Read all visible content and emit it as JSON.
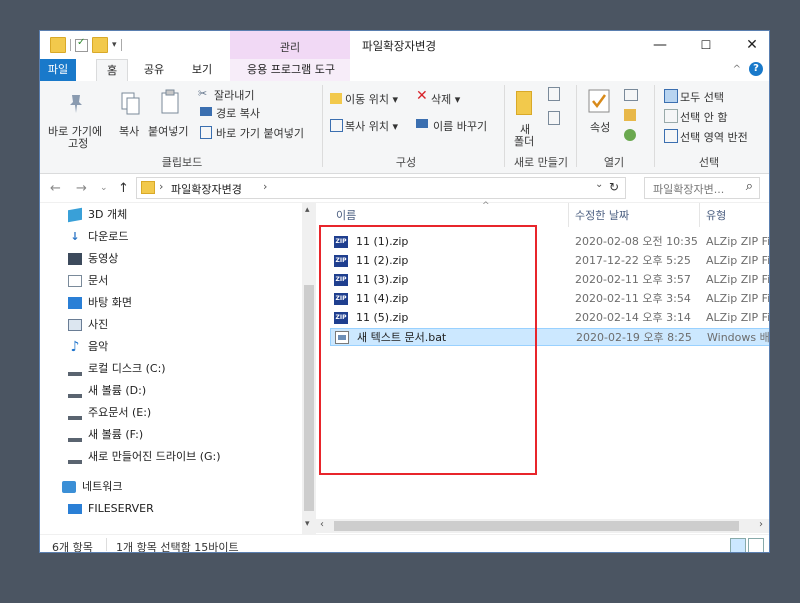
{
  "window": {
    "title": "파일확장자변경",
    "context_tab": "관리",
    "controls": {
      "minimize": "—",
      "maximize": "☐",
      "close": "✕"
    }
  },
  "ribbon_tabs": {
    "file": "파일",
    "home": "홈",
    "share": "공유",
    "view": "보기",
    "app_tools": "응용 프로그램 도구",
    "collapse": "^",
    "help": "?"
  },
  "ribbon": {
    "clipboard": {
      "pin": "바로 가기에\n고정",
      "pin_line1": "바로 가기에",
      "pin_line2": "고정",
      "copy": "복사",
      "paste": "붙여넣기",
      "cut": "잘라내기",
      "copy_path": "경로 복사",
      "paste_shortcut": "바로 가기 붙여넣기",
      "group": "클립보드"
    },
    "organize": {
      "move_to": "이동 위치 ▾",
      "delete": "삭제 ▾",
      "copy_to": "복사 위치 ▾",
      "rename": "이름 바꾸기",
      "group": "구성"
    },
    "new": {
      "new_folder_line1": "새",
      "new_folder_line2": "폴더",
      "group": "새로 만들기"
    },
    "open": {
      "properties": "속성",
      "group": "열기"
    },
    "select": {
      "select_all": "모두 선택",
      "select_none": "선택 안 함",
      "invert": "선택 영역 반전",
      "group": "선택"
    }
  },
  "address": {
    "back": "←",
    "forward": "→",
    "recent": "⌄",
    "up": "↑",
    "path": "파일확장자변경",
    "refresh": "↻",
    "dropdown": "⌄",
    "search_placeholder": "파일확장자변...",
    "search_icon": "⌕"
  },
  "nav_pane": {
    "items": [
      {
        "label": "3D 개체",
        "icon": "cube-icon"
      },
      {
        "label": "다운로드",
        "icon": "download-icon"
      },
      {
        "label": "동영상",
        "icon": "video-icon"
      },
      {
        "label": "문서",
        "icon": "document-icon"
      },
      {
        "label": "바탕 화면",
        "icon": "desktop-icon"
      },
      {
        "label": "사진",
        "icon": "picture-icon"
      },
      {
        "label": "음악",
        "icon": "music-icon"
      },
      {
        "label": "로컬 디스크 (C:)",
        "icon": "drive-icon"
      },
      {
        "label": "새 볼륨 (D:)",
        "icon": "drive-icon"
      },
      {
        "label": "주요문서 (E:)",
        "icon": "drive-icon"
      },
      {
        "label": "새 볼륨 (F:)",
        "icon": "drive-icon"
      },
      {
        "label": "새로 만들어진 드라이브 (G:)",
        "icon": "drive-icon"
      },
      {
        "label": "네트워크",
        "icon": "network-icon"
      },
      {
        "label": "FILESERVER",
        "icon": "computer-icon"
      }
    ]
  },
  "content": {
    "columns": {
      "name": "이름",
      "modified": "수정한 날짜",
      "type": "유형"
    },
    "sort_indicator": "^",
    "files": [
      {
        "name": "11 (1).zip",
        "modified": "2020-02-08 오전 10:35",
        "type": "ALZip ZIP File",
        "kind": "zip",
        "selected": false
      },
      {
        "name": "11 (2).zip",
        "modified": "2017-12-22 오후 5:25",
        "type": "ALZip ZIP File",
        "kind": "zip",
        "selected": false
      },
      {
        "name": "11 (3).zip",
        "modified": "2020-02-11 오후 3:57",
        "type": "ALZip ZIP File",
        "kind": "zip",
        "selected": false
      },
      {
        "name": "11 (4).zip",
        "modified": "2020-02-11 오후 3:54",
        "type": "ALZip ZIP File",
        "kind": "zip",
        "selected": false
      },
      {
        "name": "11 (5).zip",
        "modified": "2020-02-14 오후 3:14",
        "type": "ALZip ZIP File",
        "kind": "zip",
        "selected": false
      },
      {
        "name": "새 텍스트 문서.bat",
        "modified": "2020-02-19 오후 8:25",
        "type": "Windows 배치 파일",
        "kind": "bat",
        "selected": true
      }
    ],
    "zip_badge": "ZIP"
  },
  "status_bar": {
    "item_count": "6개 항목",
    "selection": "1개 항목 선택함 15바이트"
  },
  "colors": {
    "accent": "#1979ca",
    "context_tab": "#f1d9f5",
    "selection": "#cce8ff",
    "highlight_box": "#e8252b"
  }
}
